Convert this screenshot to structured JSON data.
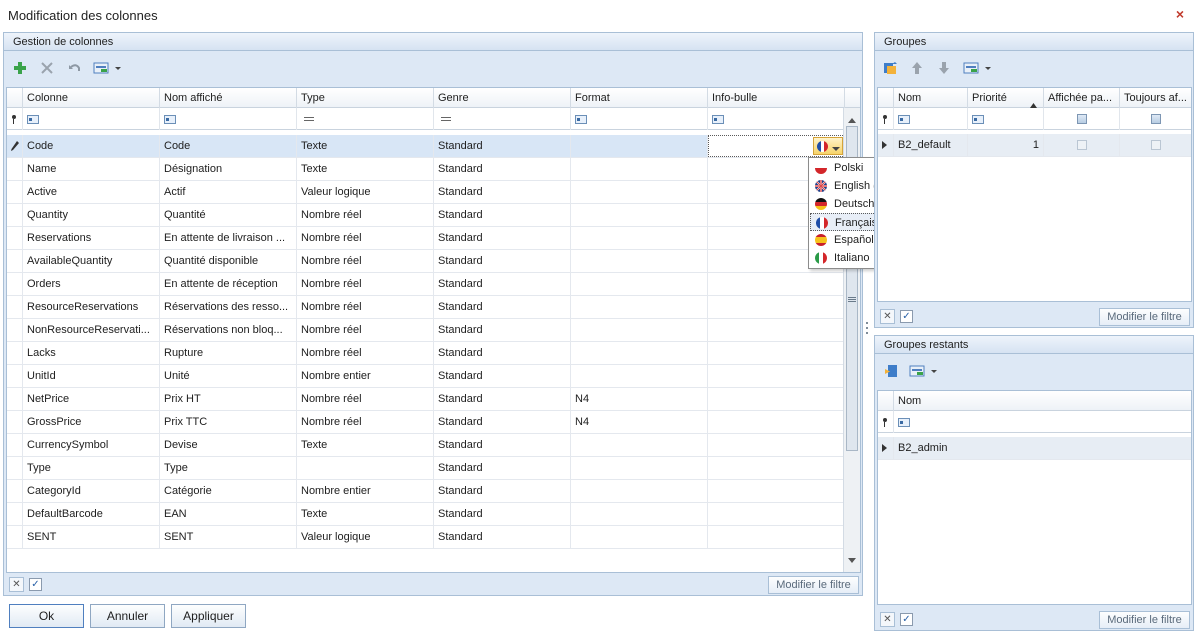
{
  "window": {
    "title": "Modification des colonnes",
    "close_glyph": "×"
  },
  "left_panel": {
    "title": "Gestion de colonnes",
    "columns": [
      "Colonne",
      "Nom affiché",
      "Type",
      "Genre",
      "Format",
      "Info-bulle"
    ],
    "rows": [
      [
        "Code",
        "Code",
        "Texte",
        "Standard",
        "",
        ""
      ],
      [
        "Name",
        "Désignation",
        "Texte",
        "Standard",
        "",
        ""
      ],
      [
        "Active",
        "Actif",
        "Valeur logique",
        "Standard",
        "",
        ""
      ],
      [
        "Quantity",
        "Quantité",
        "Nombre réel",
        "Standard",
        "",
        ""
      ],
      [
        "Reservations",
        "En attente de livraison ...",
        "Nombre réel",
        "Standard",
        "",
        ""
      ],
      [
        "AvailableQuantity",
        "Quantité disponible",
        "Nombre réel",
        "Standard",
        "",
        ""
      ],
      [
        "Orders",
        "En attente de réception",
        "Nombre réel",
        "Standard",
        "",
        ""
      ],
      [
        "ResourceReservations",
        "Réservations des resso...",
        "Nombre réel",
        "Standard",
        "",
        ""
      ],
      [
        "NonResourceReservati...",
        "Réservations non bloq...",
        "Nombre réel",
        "Standard",
        "",
        ""
      ],
      [
        "Lacks",
        "Rupture",
        "Nombre réel",
        "Standard",
        "",
        ""
      ],
      [
        "UnitId",
        "Unité",
        "Nombre entier",
        "Standard",
        "",
        ""
      ],
      [
        "NetPrice",
        "Prix HT",
        "Nombre réel",
        "Standard",
        "N4",
        ""
      ],
      [
        "GrossPrice",
        "Prix TTC",
        "Nombre réel",
        "Standard",
        "N4",
        ""
      ],
      [
        "CurrencySymbol",
        "Devise",
        "Texte",
        "Standard",
        "",
        ""
      ],
      [
        "Type",
        "Type",
        "",
        "Standard",
        "",
        ""
      ],
      [
        "CategoryId",
        "Catégorie",
        "Nombre entier",
        "Standard",
        "",
        ""
      ],
      [
        "DefaultBarcode",
        "EAN",
        "Texte",
        "Standard",
        "",
        ""
      ],
      [
        "SENT",
        "SENT",
        "Valeur logique",
        "Standard",
        "",
        ""
      ]
    ],
    "filter_button": "Modifier le filtre"
  },
  "language_dropdown": {
    "items": [
      {
        "label": "Polski",
        "flag": "pl"
      },
      {
        "label": "English (US)",
        "flag": "gb"
      },
      {
        "label": "Deutsch",
        "flag": "de"
      },
      {
        "label": "Français",
        "flag": "fr"
      },
      {
        "label": "Español",
        "flag": "es"
      },
      {
        "label": "Italiano",
        "flag": "it"
      }
    ],
    "selected": "Français"
  },
  "groups_panel": {
    "title": "Groupes",
    "columns": [
      "Nom",
      "Priorité",
      "Affichée pa...",
      "Toujours af..."
    ],
    "rows": [
      {
        "name": "B2_default",
        "priority": "1"
      }
    ],
    "filter_button": "Modifier le filtre"
  },
  "remaining_groups_panel": {
    "title": "Groupes restants",
    "columns": [
      "Nom"
    ],
    "rows": [
      {
        "name": "B2_admin"
      }
    ],
    "filter_button": "Modifier le filtre"
  },
  "buttons": {
    "ok": "Ok",
    "cancel": "Annuler",
    "apply": "Appliquer"
  },
  "colors": {
    "panel_bg": "#dde8f5",
    "border": "#a9bfd6",
    "selected_row": "#d8e6f6",
    "accent": "#4f7fbf"
  }
}
